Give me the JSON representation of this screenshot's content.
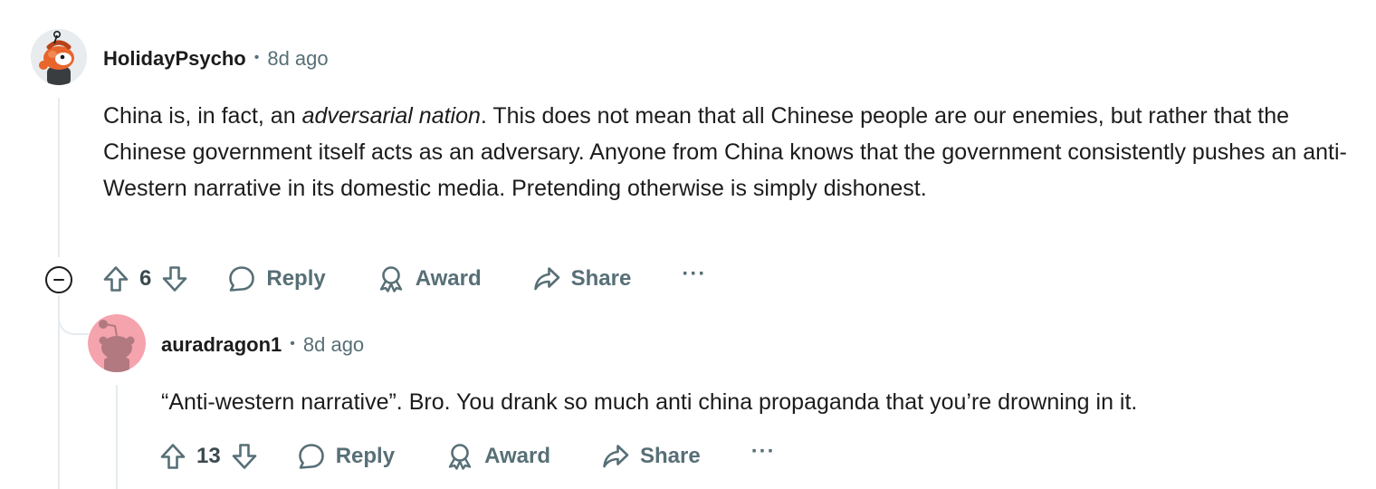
{
  "comments": [
    {
      "author": "HolidayPsycho",
      "time": "8d ago",
      "body_before": "China is, in fact, an ",
      "body_em": "adversarial nation",
      "body_after": ". This does not mean that all Chinese people are our enemies, but rather that the Chinese government itself acts as an adversary. Anyone from China knows that the government consistently pushes an anti-Western narrative in its domestic media. Pretending otherwise is simply dishonest.",
      "votes": "6",
      "reply_label": "Reply",
      "award_label": "Award",
      "share_label": "Share",
      "more_label": "···"
    },
    {
      "author": "auradragon1",
      "time": "8d ago",
      "body": "“Anti-western narrative”. Bro. You drank so much anti china propaganda that you’re drowning in it.",
      "votes": "13",
      "reply_label": "Reply",
      "award_label": "Award",
      "share_label": "Share",
      "more_label": "···"
    }
  ],
  "separator": "•",
  "colors": {
    "meta": "#576f76",
    "text": "#1c1c1c",
    "thread_line": "#e5ebee",
    "avatar2_bg": "#f5a3ad"
  }
}
